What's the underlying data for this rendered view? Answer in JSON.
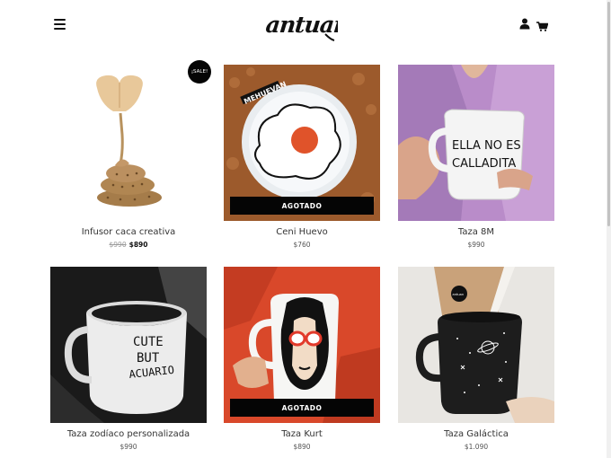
{
  "brand": {
    "logo_text": "antuan"
  },
  "header": {
    "menu_icon": "hamburger-icon",
    "user_icon": "user-icon",
    "cart_icon": "cart-icon"
  },
  "products": [
    {
      "name": "Infusor caca creativa",
      "old_price": "$990",
      "price": "$890",
      "badge": "¡SALE!",
      "sold_out": ""
    },
    {
      "name": "Ceni Huevo",
      "old_price": "",
      "price": "$760",
      "badge": "",
      "sold_out": "AGOTADO",
      "illustration_text": "MEHUEVAN"
    },
    {
      "name": "Taza 8M",
      "old_price": "",
      "price": "$990",
      "badge": "",
      "sold_out": "",
      "illustration_text": [
        "ELLA NO ES",
        "CALLADITA"
      ]
    },
    {
      "name": "Taza zodíaco personalizada",
      "old_price": "",
      "price": "$990",
      "badge": "",
      "sold_out": "",
      "illustration_text": [
        "CUTE",
        "BUT",
        "ACUARIO"
      ]
    },
    {
      "name": "Taza Kurt",
      "old_price": "",
      "price": "$890",
      "badge": "",
      "sold_out": "AGOTADO"
    },
    {
      "name": "Taza Galáctica",
      "old_price": "",
      "price": "$1.090",
      "badge": "",
      "sold_out": "",
      "illustration_text": "antuan"
    }
  ]
}
